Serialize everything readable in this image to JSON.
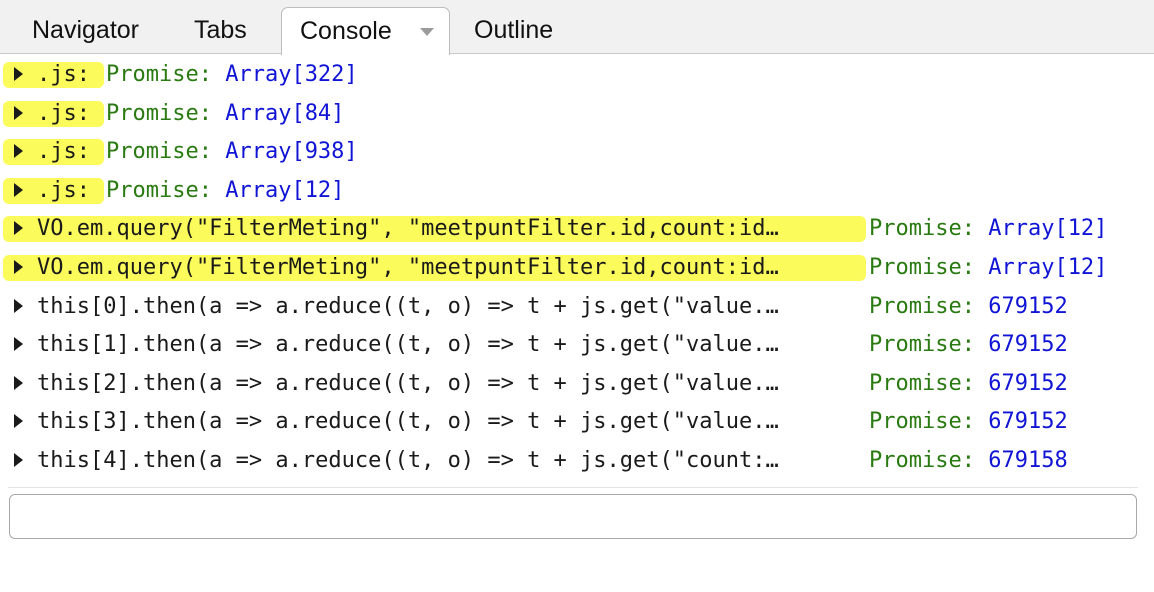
{
  "tabs": [
    {
      "label": "Navigator",
      "active": false
    },
    {
      "label": "Tabs",
      "active": false
    },
    {
      "label": "Console",
      "active": true
    },
    {
      "label": "Outline",
      "active": false
    }
  ],
  "console": {
    "rows": [
      {
        "expr": ".js:",
        "highlight": true,
        "result_kind": "Promise:",
        "result_value": "Array[322]"
      },
      {
        "expr": ".js:",
        "highlight": true,
        "result_kind": "Promise:",
        "result_value": "Array[84]"
      },
      {
        "expr": ".js:",
        "highlight": true,
        "result_kind": "Promise:",
        "result_value": "Array[938]"
      },
      {
        "expr": ".js:",
        "highlight": true,
        "result_kind": "Promise:",
        "result_value": "Array[12]"
      },
      {
        "expr": "VO.em.query(\"FilterMeting\", \"meetpuntFilter.id,count:id…",
        "highlight": true,
        "result_kind": "Promise:",
        "result_value": "Array[12]"
      },
      {
        "expr": "VO.em.query(\"FilterMeting\", \"meetpuntFilter.id,count:id…",
        "highlight": true,
        "result_kind": "Promise:",
        "result_value": "Array[12]"
      },
      {
        "expr": "this[0].then(a => a.reduce((t, o) => t + js.get(\"value.…",
        "highlight": false,
        "result_kind": "Promise:",
        "result_value": "679152"
      },
      {
        "expr": "this[1].then(a => a.reduce((t, o) => t + js.get(\"value.…",
        "highlight": false,
        "result_kind": "Promise:",
        "result_value": "679152"
      },
      {
        "expr": "this[2].then(a => a.reduce((t, o) => t + js.get(\"value.…",
        "highlight": false,
        "result_kind": "Promise:",
        "result_value": "679152"
      },
      {
        "expr": "this[3].then(a => a.reduce((t, o) => t + js.get(\"value.…",
        "highlight": false,
        "result_kind": "Promise:",
        "result_value": "679152"
      },
      {
        "expr": "this[4].then(a => a.reduce((t, o) => t + js.get(\"count:…",
        "highlight": false,
        "result_kind": "Promise:",
        "result_value": "679158"
      }
    ],
    "input_value": ""
  },
  "colors": {
    "highlight": "#fbfb5c",
    "promise_label": "#2a7a12",
    "result_value": "#1014d4"
  },
  "icons": {
    "tab_dropdown": "chevron-down-icon",
    "row_expand": "disclosure-triangle-icon"
  }
}
